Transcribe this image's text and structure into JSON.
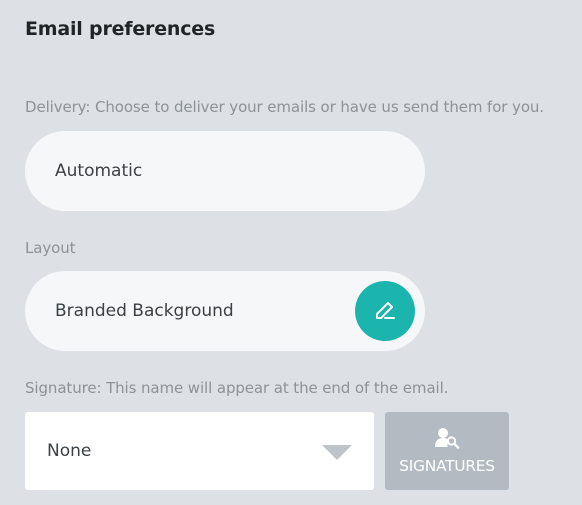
{
  "section": {
    "title": "Email preferences"
  },
  "delivery": {
    "label": "Delivery: Choose to deliver your emails or have us send them for you.",
    "value": "Automatic"
  },
  "layout": {
    "label": "Layout",
    "value": "Branded Background",
    "edit_icon": "pencil-icon",
    "accent_color": "#1cb5ae"
  },
  "signature": {
    "label": "Signature: This name will appear at the end of the email.",
    "selected": "None",
    "button_label": "SIGNATURES",
    "button_icon": "user-search-icon"
  }
}
